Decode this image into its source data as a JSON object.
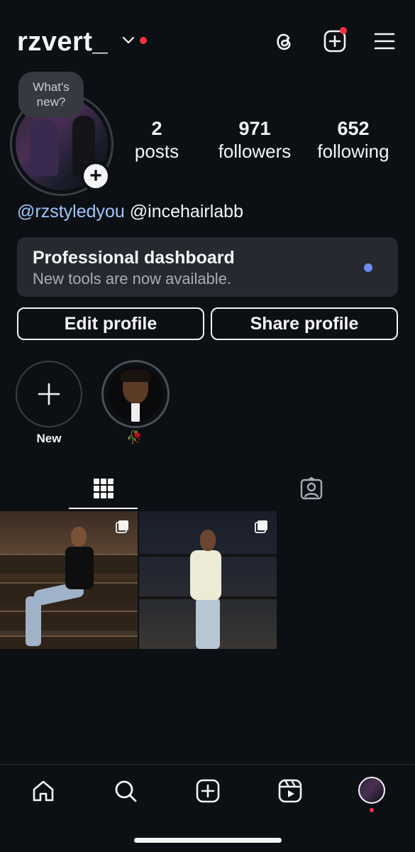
{
  "header": {
    "username": "rzvert_",
    "icons": [
      "threads-icon",
      "create-icon",
      "menu-icon"
    ]
  },
  "profile": {
    "bubble": [
      "What's",
      "new?"
    ],
    "stats": [
      {
        "value": "2",
        "label": "posts"
      },
      {
        "value": "971",
        "label": "followers"
      },
      {
        "value": "652",
        "label": "following"
      }
    ],
    "bio_mentions": [
      "@rzstyledyou",
      "@incehairlabb"
    ]
  },
  "dashboard": {
    "title": "Professional dashboard",
    "subtitle": "New tools are now available."
  },
  "buttons": {
    "edit": "Edit profile",
    "share": "Share profile"
  },
  "highlights": [
    {
      "label": "New"
    },
    {
      "label": "🥀"
    }
  ],
  "tabs": [
    "grid-icon",
    "tagged-icon"
  ],
  "colors": {
    "background": "#0c1014",
    "link": "#9fc7ff",
    "notification": "#ff3040",
    "dashboard_dot": "#6d8ef0"
  },
  "bottom_nav": [
    "home-icon",
    "search-icon",
    "create-icon",
    "reels-icon",
    "profile-avatar"
  ]
}
